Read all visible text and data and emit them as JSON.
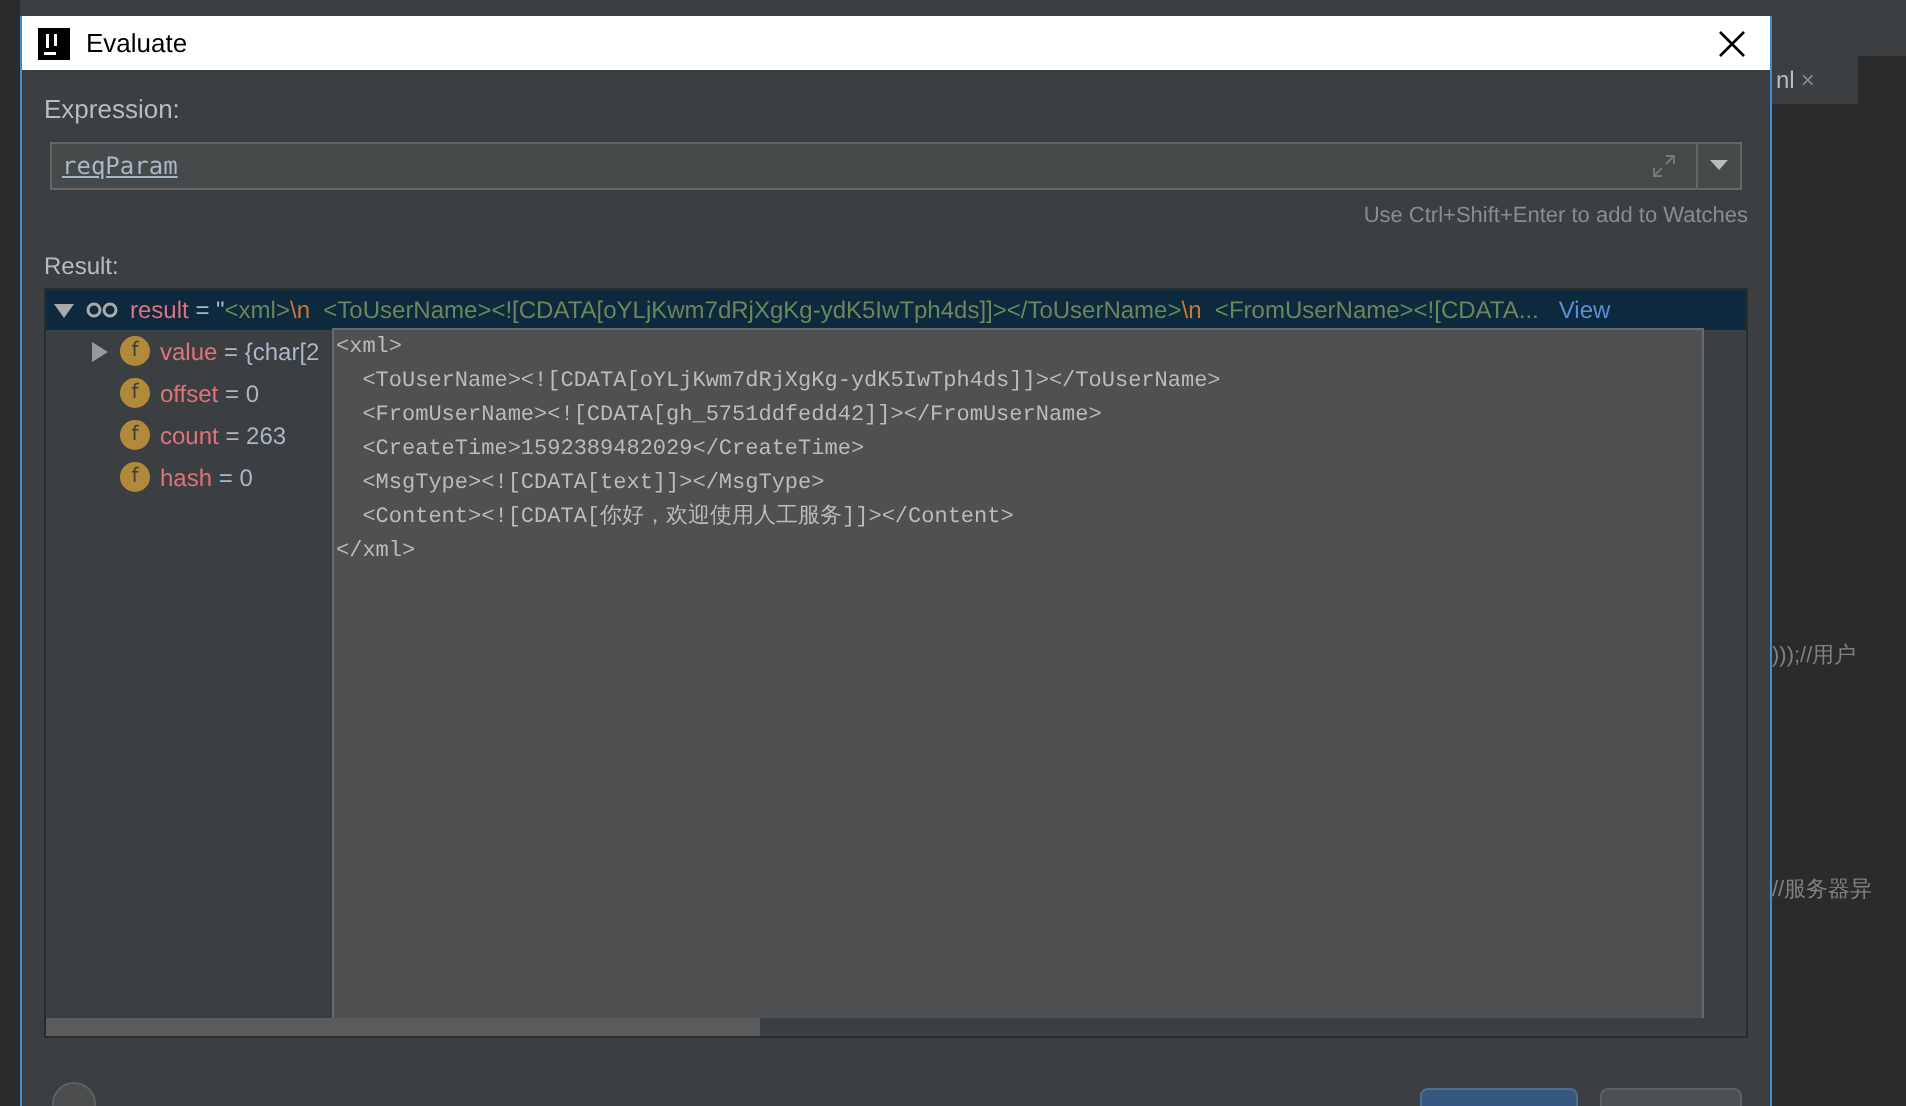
{
  "window": {
    "title": "Evaluate"
  },
  "expression": {
    "label": "Expression:",
    "value": "reqParam",
    "hint": "Use Ctrl+Shift+Enter to add to Watches"
  },
  "result": {
    "label": "Result:",
    "root": {
      "name": "result",
      "expanded": true,
      "selected": true,
      "segments": [
        {
          "kind": "plain",
          "text": "= \""
        },
        {
          "kind": "string",
          "text": "<xml>"
        },
        {
          "kind": "escape",
          "text": "\\n"
        },
        {
          "kind": "string",
          "text": "  <ToUserName><![CDATA[oYLjKwm7dRjXgKg-ydK5IwTph4ds]]></ToUserName>"
        },
        {
          "kind": "escape",
          "text": "\\n"
        },
        {
          "kind": "string",
          "text": "  <FromUserName><![CDATA..."
        }
      ],
      "link": "View"
    },
    "children": [
      {
        "icon": "f",
        "name": "value",
        "value": "= {char[2",
        "expanded": false
      },
      {
        "icon": "f",
        "name": "offset",
        "value": "= 0"
      },
      {
        "icon": "f",
        "name": "count",
        "value": "= 263"
      },
      {
        "icon": "f",
        "name": "hash",
        "value": "= 0"
      }
    ]
  },
  "popup": {
    "lines": [
      "<xml>",
      "  <ToUserName><![CDATA[oYLjKwm7dRjXgKg-ydK5IwTph4ds]]></ToUserName>",
      "  <FromUserName><![CDATA[gh_5751ddfedd42]]></FromUserName>",
      "  <CreateTime>1592389482029</CreateTime>",
      "  <MsgType><![CDATA[text]]></MsgType>",
      "  <Content><![CDATA[你好，欢迎使用人工服务]]></Content>",
      "</xml>"
    ]
  },
  "background_editor": {
    "tab": "nl",
    "tab_close": "×",
    "lines": [
      ")));//用户",
      "//服务器异"
    ]
  }
}
